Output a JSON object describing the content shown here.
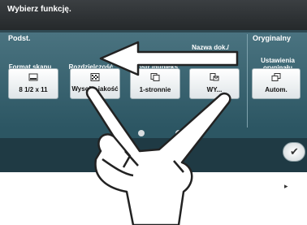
{
  "header": {
    "title": "Wybierz funkcję."
  },
  "sections": {
    "basic": "Podst.",
    "original": "Oryginalny"
  },
  "functions": [
    {
      "label": "Format skanu",
      "value": "8 1/2 x 11",
      "icon": "paper-size-icon"
    },
    {
      "label": "Rozdzielczość",
      "value": "Wysoka jakość",
      "icon": "resolution-icon"
    },
    {
      "label": "Jednostr./dupleks",
      "value": "1-stronnie",
      "icon": "simplex-duplex-icon"
    },
    {
      "label": "Nazwa dok./ Temat/ Inne",
      "value": "WY...",
      "icon": "document-name-icon"
    },
    {
      "label": "Ustawienia oryginału",
      "value": "Autom.",
      "icon": "original-settings-icon"
    }
  ],
  "gesture": {
    "type": "two-finger swipe left",
    "arrow_direction": "left"
  },
  "colors": {
    "panel_top": "#4a7380",
    "panel_bottom": "#2c5663",
    "header": "#2f3336"
  }
}
